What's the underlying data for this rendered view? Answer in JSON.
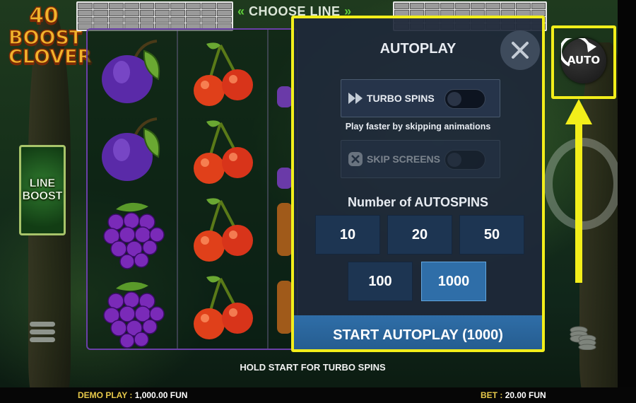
{
  "logo": {
    "line1": "40",
    "line2": "BOOST",
    "line3": "CLOVER"
  },
  "line_boost": {
    "line1": "LINE",
    "line2": "BOOST"
  },
  "choose_line": "CHOOSE LINE",
  "autoplay": {
    "title": "AUTOPLAY",
    "turbo_label": "TURBO SPINS",
    "turbo_hint": "Play faster by skipping animations",
    "skip_label": "SKIP SCREENS",
    "count_title": "Number of AUTOSPINS",
    "options": [
      "10",
      "20",
      "50",
      "100",
      "1000"
    ],
    "selected": "1000",
    "start_label": "START AUTOPLAY (1000)"
  },
  "auto_button_label": "AUTO",
  "hold_start": "HOLD START FOR TURBO SPINS",
  "status": {
    "demo_label": "DEMO PLAY :",
    "demo_value": "1,000.00 FUN",
    "bet_label": "BET :",
    "bet_value": "20.00 FUN"
  },
  "reels": {
    "col1": [
      "plum",
      "plum",
      "grapes",
      "grapes"
    ],
    "col2": [
      "cherries",
      "cherries",
      "cherries",
      "cherries"
    ]
  },
  "colors": {
    "highlight": "#f2ee1a",
    "selected_option": "#2f6ea8",
    "option": "#1d3552",
    "reel_border": "#6a3fa8"
  }
}
